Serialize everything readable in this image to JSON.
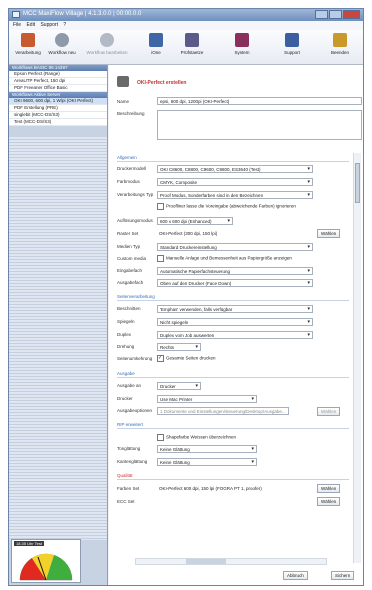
{
  "window": {
    "title": "MCC MaxiFlow Village | 4.1.3.0.0 | 00:00.0.0"
  },
  "menu": [
    "File",
    "Edit",
    "Support",
    "?"
  ],
  "toolbar": {
    "buttons": [
      {
        "label": "Verarbeitung",
        "color": "#c85a2f"
      },
      {
        "label": "Workflow neu",
        "color": "#8e99a9"
      },
      {
        "label": "Workflow bearbeiten",
        "color": "#9aa3b0"
      },
      {
        "label": "iOne",
        "color": "#3f67a8"
      },
      {
        "label": "Prüfstaetze",
        "color": "#5b5b8a"
      },
      {
        "label": "System",
        "color": "#8b2f5c"
      },
      {
        "label": "Support",
        "color": "#3d5fa0"
      },
      {
        "label": "Beenden",
        "color": "#c99a2a"
      }
    ]
  },
  "left": {
    "groups": [
      {
        "title": "Workflows BASIC 96.14397",
        "items": [
          "Epson Perfect (Range)",
          "AreaUTP Perfect, 150 dpi",
          "PDF Freeaner Office Basic"
        ]
      },
      {
        "title": "Workflows Aktive Server",
        "items": [
          "OKI 9600, 600 dpi, 1 W/pi (OKI Perfect)",
          "PDF Erstellung (PRE)",
          "singlebit (MCC-DS/S3)",
          "Test (MCC-DS/S3)"
        ]
      }
    ],
    "gauge_caption": "18.35 Uhr Test"
  },
  "main": {
    "title": "OKI-Perfect erstellen",
    "name_label": "Name",
    "name_value": "epsi, 600 dpi, 1200pi (OKI-Perfect)",
    "desc_label": "Beschreibung",
    "sections": {
      "allgemein": "Allgemein",
      "seitenverarbeitung": "Seitenverarbeitung",
      "ausgabe": "Ausgabe",
      "rip": "RIP erweitert",
      "qualitaet": "Qualität"
    },
    "fields": {
      "druckermodell": {
        "label": "Druckermodell",
        "value": "OKI C8600, C8800, C9600, C9800, ES3640 (Test)"
      },
      "farbmodus": {
        "label": "Farbmodus",
        "value": "CMYK, Composite"
      },
      "verarbeitung": {
        "label": "Verarbeitungs Typ",
        "value": "Proof Modus, Sonderfarben sind in den Bezeichnen"
      },
      "check_proof": "Proofliner lasse die Voreingabe (abweichende Farben) ignorieren",
      "aufloesung": {
        "label": "Auflösungsmodus",
        "value": "600 x 600 dpi (Enhanced)"
      },
      "raster": {
        "label": "Raster Set",
        "value": "OKI-Perfect (300 dpi, 150 lpi)",
        "btn": "Wählen"
      },
      "medien": {
        "label": "Medien Typ",
        "value": "Standard Druckereinstellung"
      },
      "custom": {
        "label": "Custom media",
        "check": "Manuelle Anlage und Bemessenheit aus Papiergröße anzeigen"
      },
      "eingabefach": {
        "label": "Eingabefach",
        "value": "Automatische Papierfachsteuerung"
      },
      "ausgabefach": {
        "label": "Ausgabefach",
        "value": "Oben auf den Drucker (Face Down)"
      },
      "beschnitt": {
        "label": "Beschnitten",
        "value": "'Emphas' verwenden, falls verfügbar"
      },
      "spiegeln": {
        "label": "Spiegeln",
        "value": "Nicht spiegeln"
      },
      "duplex": {
        "label": "Duplex",
        "value": "Duplex vom Job auswerten"
      },
      "drehung": {
        "label": "Drehung",
        "value": "Rechts"
      },
      "seitenumkehr": {
        "label": "Seitenumkehrung",
        "check": "Gesamte Seiten drucken"
      },
      "ausgabe_an": {
        "label": "Ausgabe an",
        "value": "Drucker"
      },
      "drucker": {
        "label": "Drucker",
        "value": "Use Mac Printer"
      },
      "ausgabeoptionen": {
        "label": "Ausgabeoptionen",
        "value": "1 Dokumente und Einstellungen/steuerung/Desktop/Ausgabe...",
        "btn": "Wählen"
      },
      "rip_check": "Shapefarbe Weissen überzeichnen",
      "tonglättung": {
        "label": "Tonglättung",
        "value": "Keine Glättung"
      },
      "kantenglaettung": {
        "label": "Kantenglättung",
        "value": "Keine Glättung"
      },
      "farbset": {
        "label": "Farben Set",
        "value": "OKI-Perfect 600 dpi, 150 lpi (FOGRA PT 1, proofer)",
        "btn": "Wählen"
      },
      "ecc": {
        "label": "ECC Set",
        "value": "",
        "btn": "Wählen"
      }
    },
    "footer": {
      "cancel": "Abbruch",
      "save": "Sichern"
    }
  }
}
